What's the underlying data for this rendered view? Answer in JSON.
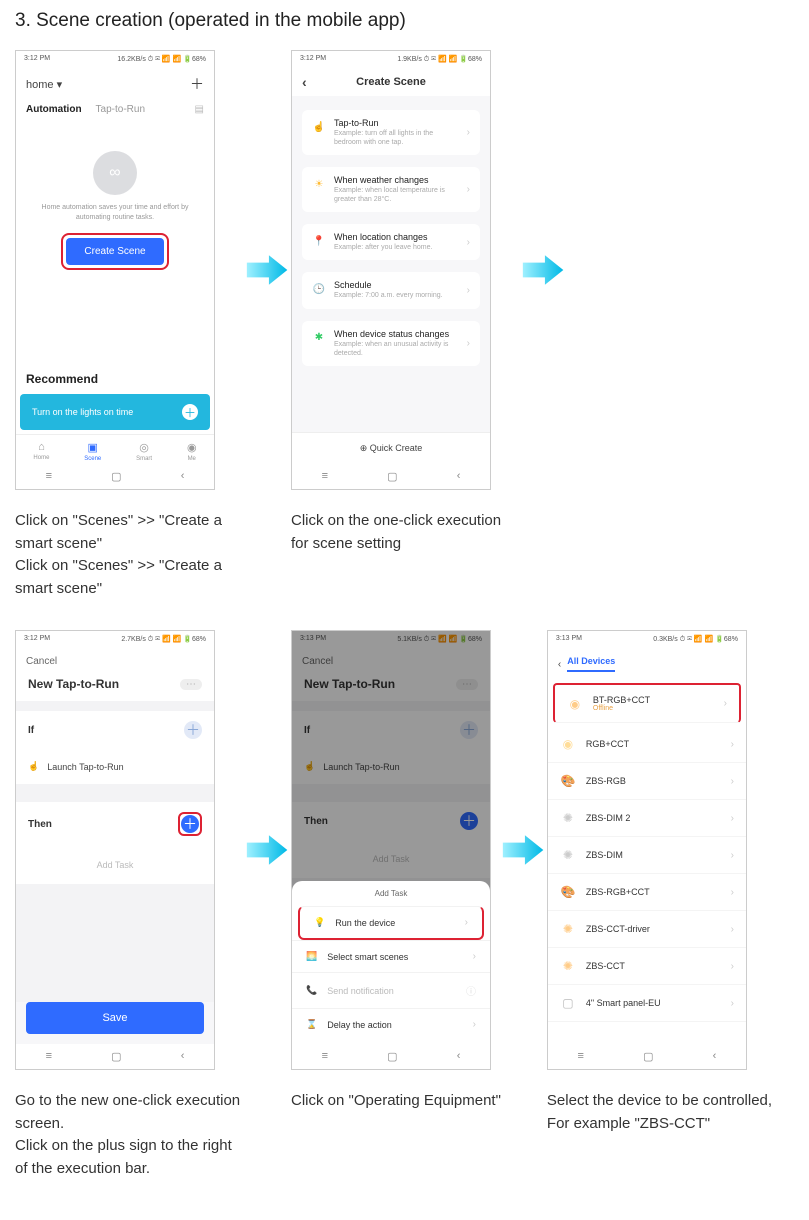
{
  "page_title": "3. Scene creation (operated in the mobile app)",
  "status": {
    "time1": "3:12 PM",
    "right1": "16.2KB/s ⏱ ✉ 📶 📶 🔋68%",
    "time2": "3:12 PM",
    "right2": "1.9KB/s ⏱ ✉ 📶 📶 🔋68%",
    "time3": "3:12 PM",
    "right3": "2.7KB/s ⏱ ✉ 📶 📶 🔋68%",
    "time4": "3:13 PM",
    "right4": "5.1KB/s ⏱ ✉ 📶 📶 🔋68%",
    "time5": "3:13 PM",
    "right5": "0.3KB/s ⏱ ✉ 📶 📶 🔋68%"
  },
  "s1": {
    "home": "home ▾",
    "plus": "＋",
    "tab_auto": "Automation",
    "tab_tap": "Tap-to-Run",
    "hint": "Home automation saves your time and effort by automating routine tasks.",
    "create": "Create Scene",
    "recommend": "Recommend",
    "reco1": "Turn on the lights on time",
    "nav_home": "Home",
    "nav_scene": "Scene",
    "nav_smart": "Smart",
    "nav_me": "Me"
  },
  "s2": {
    "title": "Create Scene",
    "i1t": "Tap-to-Run",
    "i1s": "Example: turn off all lights in the bedroom with one tap.",
    "i2t": "When weather changes",
    "i2s": "Example: when local temperature is greater than 28°C.",
    "i3t": "When location changes",
    "i3s": "Example: after you leave home.",
    "i4t": "Schedule",
    "i4s": "Example: 7:00 a.m. every morning.",
    "i5t": "When device status changes",
    "i5s": "Example: when an unusual activity is detected.",
    "quick": "⊕ Quick Create"
  },
  "s3": {
    "cancel": "Cancel",
    "title": "New Tap-to-Run",
    "more": "⋯",
    "if": "If",
    "launch": "Launch Tap-to-Run",
    "then": "Then",
    "addtask": "Add Task",
    "save": "Save"
  },
  "s4": {
    "sheet_title": "Add Task",
    "o1": "Run the device",
    "o2": "Select smart scenes",
    "o3": "Send notification",
    "o4": "Delay the action"
  },
  "s5": {
    "tab": "All Devices",
    "d1": "BT-RGB+CCT",
    "d1s": "Offline",
    "d2": "RGB+CCT",
    "d3": "ZBS-RGB",
    "d4": "ZBS-DIM 2",
    "d5": "ZBS-DIM",
    "d6": "ZBS-RGB+CCT",
    "d7": "ZBS-CCT-driver",
    "d8": "ZBS-CCT",
    "d9": "4\" Smart panel-EU"
  },
  "captions": {
    "c1": "Click on \"Scenes\" >> \"Create a smart scene\"\nClick on \"Scenes\" >> \"Create a smart scene\"",
    "c2": "Click on the one-click execution for scene setting",
    "c3": "Go to the new one-click execution screen.\nClick on the plus sign to the right of the execution bar.",
    "c4": "Click on \"Operating Equipment\"",
    "c5": "Select the device to be controlled, For example \"ZBS-CCT\""
  }
}
